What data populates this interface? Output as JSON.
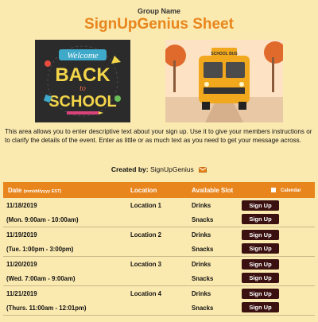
{
  "header": {
    "group_name": "Group Name",
    "title": "SignUpGenius Sheet"
  },
  "images": {
    "left": {
      "line1": "Welcome",
      "line2": "BACK",
      "line3": "to",
      "line4": "SCHOOL"
    },
    "right": {
      "bus_sign": "SCHOOL BUS"
    }
  },
  "description": "This area allows you to enter descriptive text about your sign up. Use it to give your members instructions or to clarify the details of the event. Enter as little or as much text as you need to get your message across.",
  "created_by": {
    "label": "Created by:",
    "name": "SignUpGenius"
  },
  "table": {
    "headers": {
      "date": "Date",
      "date_hint": "(mm/dd/yyyy  EST)",
      "location": "Location",
      "slot": "Available Slot",
      "calendar": "Calendar"
    },
    "button_label": "Sign Up",
    "rows": [
      {
        "date": "11/18/2019",
        "time": "(Mon. 9:00am - 10:00am)",
        "location": "Location 1",
        "slot1": "Drinks",
        "slot2": "Snacks"
      },
      {
        "date": "11/19/2019",
        "time": "(Tue. 1:00pm - 3:00pm)",
        "location": "Location 2",
        "slot1": "Drinks",
        "slot2": "Snacks"
      },
      {
        "date": "11/20/2019",
        "time": "(Wed. 7:00am - 9:00am)",
        "location": "Location 3",
        "slot1": "Drinks",
        "slot2": "Snacks"
      },
      {
        "date": "11/21/2019",
        "time": "(Thurs. 11:00am - 12:01pm)",
        "location": "Location 4",
        "slot1": "Drinks",
        "slot2": "Snacks"
      }
    ]
  },
  "colors": {
    "background": "#fbeab0",
    "accent": "#e8851c",
    "button": "#3a1010"
  }
}
